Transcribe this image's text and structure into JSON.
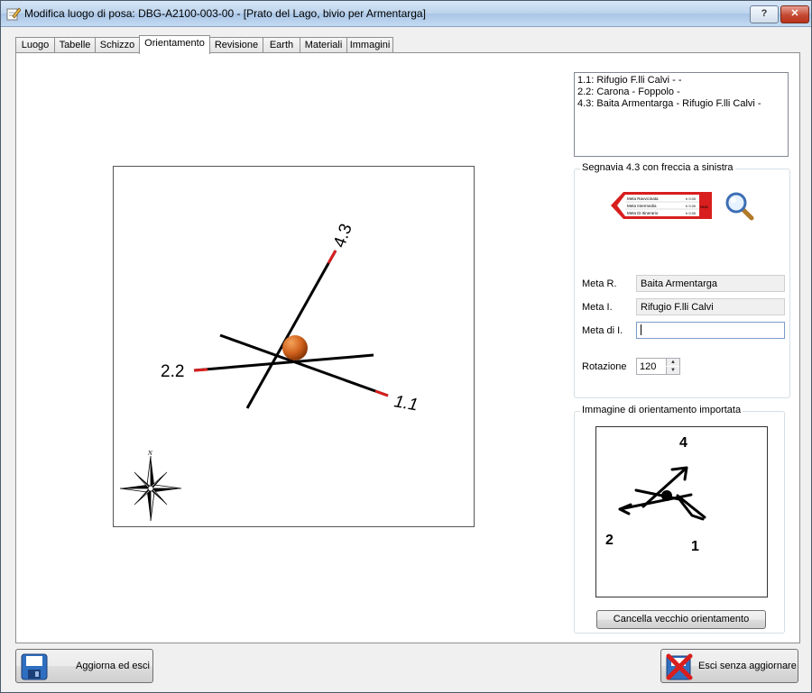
{
  "window": {
    "title": "Modifica luogo di posa: DBG-A2100-003-00 - [Prato del Lago, bivio per Armentarga]",
    "help_label": "?"
  },
  "tabs": [
    {
      "label": "Luogo"
    },
    {
      "label": "Tabelle"
    },
    {
      "label": "Schizzo"
    },
    {
      "label": "Orientamento",
      "active": true
    },
    {
      "label": "Revisione"
    },
    {
      "label": "Earth"
    },
    {
      "label": "Materiali"
    },
    {
      "label": "Immagini"
    }
  ],
  "directions_list": [
    "1.1: Rifugio F.lli Calvi -  -",
    "2.2: Carona - Foppolo -",
    "4.3: Baita Armentarga - Rifugio F.lli Calvi -"
  ],
  "orientation_diagram": {
    "labels": [
      "4.3",
      "2.2",
      "1.1"
    ],
    "compass_north": "N"
  },
  "sign_group": {
    "title": "Segnavia 4.3 con freccia a sinistra",
    "sign_rows": [
      "Meta Ravvicinata",
      "Meta Intermedia",
      "Meta Di Itinerario"
    ],
    "sign_times": [
      "h 0.00",
      "h 0.00",
      "h 0.00"
    ],
    "sign_code": "NNN"
  },
  "fields": {
    "meta_r_label": "Meta R.",
    "meta_r_value": "Baita Armentarga",
    "meta_i_label": "Meta I.",
    "meta_i_value": "Rifugio F.lli Calvi",
    "meta_di_i_label": "Meta di I.",
    "meta_di_i_value": "",
    "rotazione_label": "Rotazione",
    "rotazione_value": "120"
  },
  "imported_group": {
    "title": "Immagine di orientamento importata",
    "labels": [
      "4",
      "2",
      "1"
    ],
    "cancel_button": "Cancella vecchio orientamento"
  },
  "footer": {
    "save_button": "Aggiorna ed esci",
    "exit_button": "Esci senza aggiornare"
  },
  "colors": {
    "accent_red": "#d81e1e",
    "marker_orange": "#d0621c",
    "title_bar": "#bcd3ec"
  }
}
